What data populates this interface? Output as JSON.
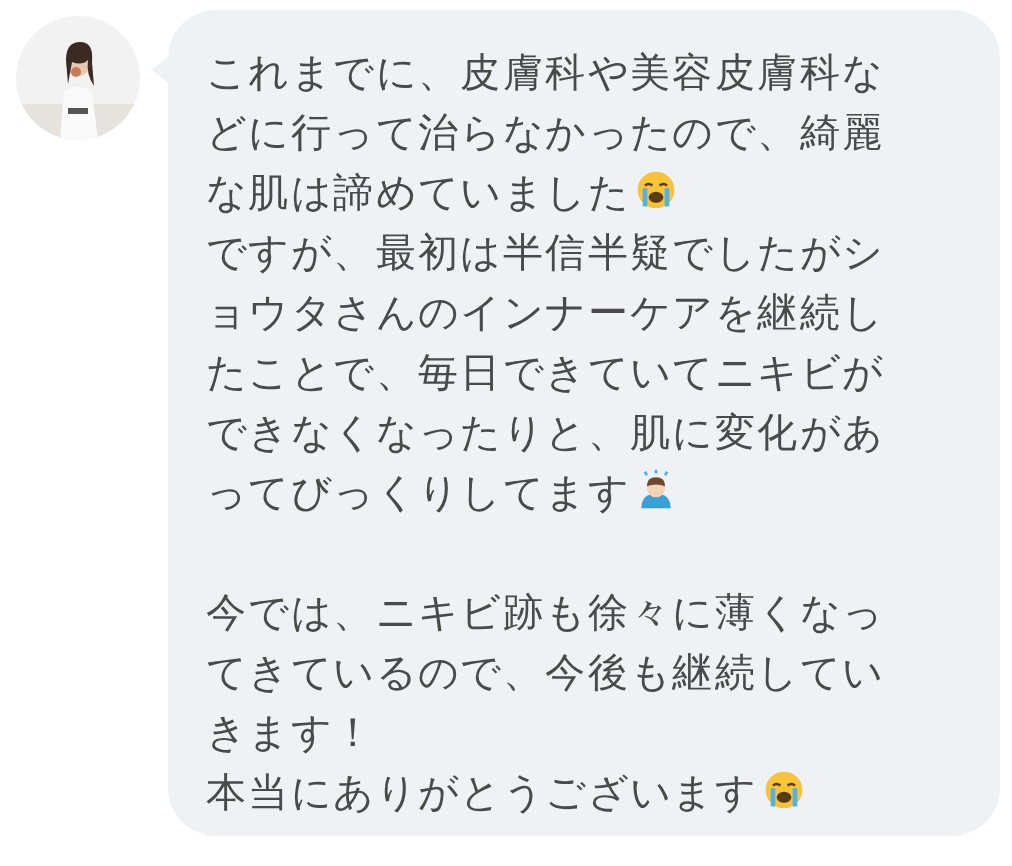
{
  "message": {
    "paragraphs": [
      {
        "lines": [
          "これまでに、皮膚科や美容皮膚科な",
          "どに行って治らなかったので、綺麗",
          "な肌は諦めていました"
        ],
        "crying_face": true,
        "bowing_person": false
      },
      {
        "lines": [
          "ですが、最初は半信半疑でしたがシ",
          "ョウタさんのインナーケアを継続し",
          "たことで、毎日できていてニキビが",
          "できなくなったりと、肌に変化があ",
          "ってびっくりしてます"
        ],
        "crying_face": false,
        "bowing_person": true
      },
      {
        "lines": [
          "今では、ニキビ跡も徐々に薄くなっ",
          "てきているので、今後も継続してい",
          "きます！"
        ],
        "crying_face": false,
        "bowing_person": false
      },
      {
        "lines": [
          "本当にありがとうございます"
        ],
        "crying_face": true,
        "bowing_person": false
      }
    ]
  }
}
